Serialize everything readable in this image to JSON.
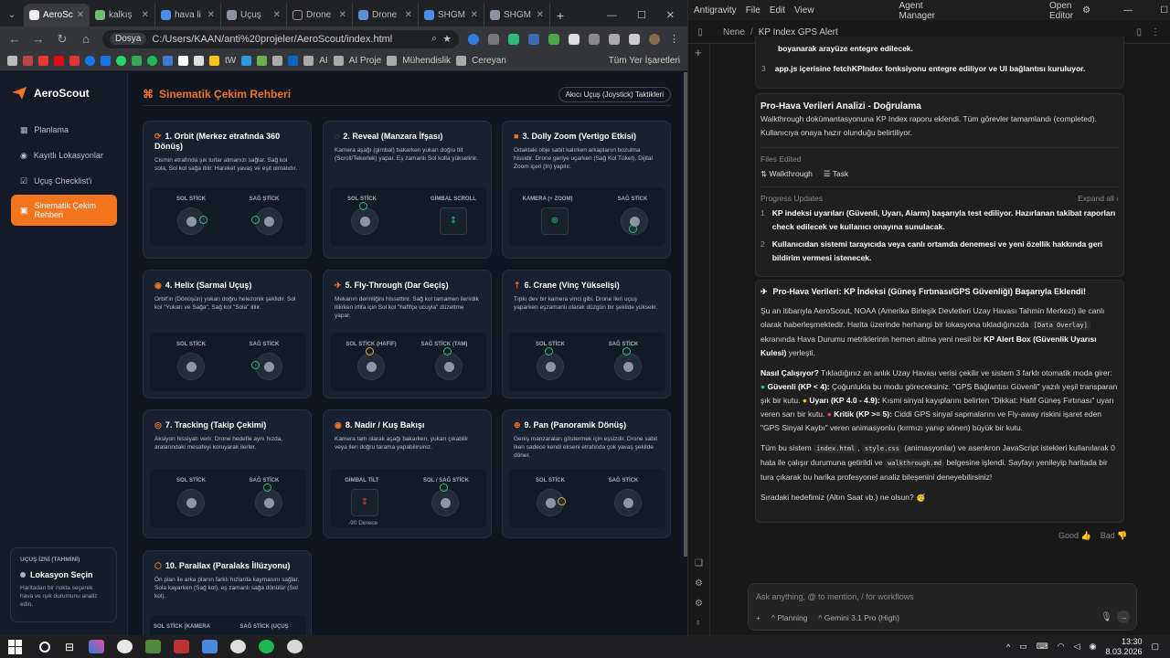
{
  "browser": {
    "tabs": [
      "AeroSc",
      "kalkış",
      "hava li",
      "Uçuş",
      "Drone",
      "Drone",
      "SHGM",
      "SHGM"
    ],
    "url_chip": "Dosya",
    "url": "C:/Users/KAAN/anti%20projeler/AeroScout/index.html",
    "bookmarks": [
      "AI",
      "AI Proje",
      "Mühendislik",
      "Cereyan",
      "Tüm Yer İşaretleri"
    ],
    "bookmark_tw": "tW"
  },
  "app": {
    "logo": "AeroScout",
    "nav": [
      "Planlama",
      "Kayıtlı Lokasyonlar",
      "Uçuş Checklist'i",
      "Sinematik Çekim Rehberi"
    ],
    "info_label": "UÇUŞ İZNİ (TAHMİNİ)",
    "info_title": "Lokasyon Seçin",
    "info_desc": "Haritadan bir nokta seçerek hava ve ışık durumunu analiz edin.",
    "page_title": "Sinematik Çekim Rehberi",
    "header_button": "Akıcı Uçuş (Joystick) Taktikleri",
    "cards": [
      {
        "title": "1. Orbit (Merkez etrafında 360 Dönüş)",
        "desc": "Cismin etrafında şık turlar atmanızı sağlar. Sağ kol sola, Sol kol sağa itilir. Hareket yavaş ve eşit olmalıdır.",
        "labels": [
          "SOL STİCK",
          "SAĞ STİCK"
        ]
      },
      {
        "title": "2. Reveal (Manzara İfşası)",
        "desc": "Kamera aşağı (gimbal) bakarken yukarı doğru tilt (Scroll/Tekerlek) yapar. Eş zamanlı Sol kolla yükselinir.",
        "labels": [
          "SOL STİCK",
          "GİMBAL SCROLL"
        ]
      },
      {
        "title": "3. Dolly Zoom (Vertigo Etkisi)",
        "desc": "Odaktaki obje sabit kalırken arkaplanın bozulma hissidir. Drone geriye uçarken (Sağ Kol Tüket), Dijital Zoom içeri (In) yapılır.",
        "labels": [
          "KAMERA (+ ZOOM)",
          "SAĞ STİCK"
        ]
      },
      {
        "title": "4. Helix (Sarmal Uçuş)",
        "desc": "Orbit'in (Dönüşün) yukarı doğru helezonik şeklidir. Sol kol \"Yukarı ve Sağa\", Sağ kol \"Sola\" itilir.",
        "labels": [
          "SOL STİCK",
          "SAĞ STİCK"
        ]
      },
      {
        "title": "5. Fly-Through (Dar Geçiş)",
        "desc": "Mekanın derinliğini hissettirir. Sağ kol tamamen ileri/dik itilirken irtifa için Sol kol \"hafifçe ucuyla\" düzeltme yapar.",
        "labels": [
          "SOL STİCK (HAFİF)",
          "SAĞ STİCK (TAM)"
        ]
      },
      {
        "title": "6. Crane (Vinç Yükselişi)",
        "desc": "Tıpkı dev bir kamera vinci gibi. Drone ileri uçuş yaparken eşzamanlı olarak düzgün bir şekilde yükselir.",
        "labels": [
          "SOL STİCK",
          "SAĞ STİCK"
        ]
      },
      {
        "title": "7. Tracking (Takip Çekimi)",
        "desc": "Aksiyon hissiyatı verir. Drone hedefle aynı hızda, aralarındaki mesafeyi koruyarak ilerler.",
        "labels": [
          "SOL STİCK",
          "SAĞ STİCK"
        ]
      },
      {
        "title": "8. Nadir / Kuş Bakışı",
        "desc": "Kamera tam olarak aşağı bakarken, yukarı çıkabilir veya ileri doğru tarama yapabilirsiniz.",
        "labels": [
          "GİMBAL TİLT",
          "SOL / SAĞ STİCK"
        ],
        "extra": "-90 Derece"
      },
      {
        "title": "9. Pan (Panoramik Dönüş)",
        "desc": "Geniş manzaraları göstermek için eşsizdir. Drone sabit iken sadece kendi ekseni etrafında çok yavaş şekilde döner.",
        "labels": [
          "SOL STİCK",
          "SAĞ STİCK"
        ]
      },
      {
        "title": "10. Parallax (Paralaks İllüzyonu)",
        "desc": "Ön plan ile arka planın farklı hızlarda kaymasını sağlar. Sola kayarken (Sağ kol), eş zamanlı sağa dönülür (Sol kol).",
        "labels": [
          "SOL STİCK (KAMERA",
          "SAĞ STİCK (UÇUŞ"
        ]
      }
    ]
  },
  "agent": {
    "menu": [
      "Antigravity",
      "File",
      "Edit",
      "View"
    ],
    "title": "Agent Manager",
    "open_editor": "Open Editor",
    "breadcrumb_root": "Nene",
    "breadcrumb_page": "KP Index GPS Alert",
    "top_items": [
      {
        "n": "",
        "text": "boyanarak arayüze entegre edilecek."
      },
      {
        "n": "3",
        "text": "app.js içerisine fetchKPIndex fonksiyonu entegre ediliyor ve UI bağlantısı kuruluyor."
      }
    ],
    "section_title": "Pro-Hava Verileri Analizi - Doğrulama",
    "section_desc": "Walkthrough dokümantasyonuna KP Index raporu eklendi. Tüm görevler tamamlandı (completed). Kullanıcıya onaya hazır olunduğu belirtiliyor.",
    "files_label": "Files Edited",
    "files": [
      "Walkthrough",
      "Task"
    ],
    "progress_label": "Progress Updates",
    "expand": "Expand all",
    "progress": [
      {
        "n": "1",
        "text": "KP indeksi uyarıları (Güvenli, Uyarı, Alarm) başarıyla test ediliyor. Hazırlanan takibat raporları check edilecek ve kullanıcı onayına sunulacak."
      },
      {
        "n": "2",
        "text": "Kullanıcıdan sistemi tarayıcıda veya canlı ortamda denemesi ve yeni özellik hakkında geri bildirim vermesi istenecek."
      }
    ],
    "msg_title": "Pro-Hava Verileri: KP İndeksi (Güneş Fırtınası/GPS Güvenliği) Başarıyla Eklendi!",
    "p1_a": "Şu an itibarıyla AeroScout, NOAA (Amerika Birleşik Devletleri Uzay Havası Tahmin Merkezi) ile canlı olarak haberleşmektedir. Harita üzerinde herhangi bir lokasyona tıkladığınızda ",
    "p1_code": "[Data Overlay]",
    "p1_b": " ekranında Hava Durumu metriklerinin hemen altına yeni nesil bir ",
    "p1_bold": "KP Alert Box (Güvenlik Uyarısı Kulesi)",
    "p1_c": " yerleşti.",
    "p2_q": "Nasıl Çalışıyor?",
    "p2_a": " Tıkladığınız an anlık Uzay Havası verisi çekilir ve sistem 3 farklı otomatik moda girer: ",
    "p2_safe": "Güvenli (KP < 4):",
    "p2_b": " Çoğunlukla bu modu göreceksiniz. \"GPS Bağlantısı Güvenli\" yazılı yeşil transparan şık bir kutu. ",
    "p2_warn": "Uyarı (KP 4.0 - 4.9):",
    "p2_c": " Kısmi sinyal kayıplarını belirten \"Dikkat: Hafif Güneş Fırtınası\" uyarı veren sarı bir kutu. ",
    "p2_crit": "Kritik (KP >= 5):",
    "p2_d": " Ciddi GPS sinyal sapmalarını ve Fly-away riskini işaret eden \"GPS Sinyal Kaybı\" veren animasyonlu (kırmızı yanıp sönen) büyük bir kutu.",
    "p3_a": "Tüm bu sistem ",
    "p3_c1": "index.html",
    "p3_c2": "style.css",
    "p3_b": " (animasyonlar) ve asenkron JavaScript istekleri kullanılarak 0 hata ile çalışır durumuna getirildi ve ",
    "p3_c3": "walkthrough.md",
    "p3_c": " belgesine işlendi. Sayfayı yenileyip haritada bir tura çıkarak bu harika profesyonel analiz bileşenini deneyebilirsiniz!",
    "p4": "Sıradaki hedefimiz (Altın Saat vb.) ne olsun? 🥳",
    "good": "Good",
    "bad": "Bad",
    "input_placeholder": "Ask anything, @ to mention, / for workflows",
    "mode": "Planning",
    "model": "Gemini 3.1 Pro (High)"
  },
  "taskbar": {
    "time": "13:30",
    "date": "8.03.2026"
  }
}
